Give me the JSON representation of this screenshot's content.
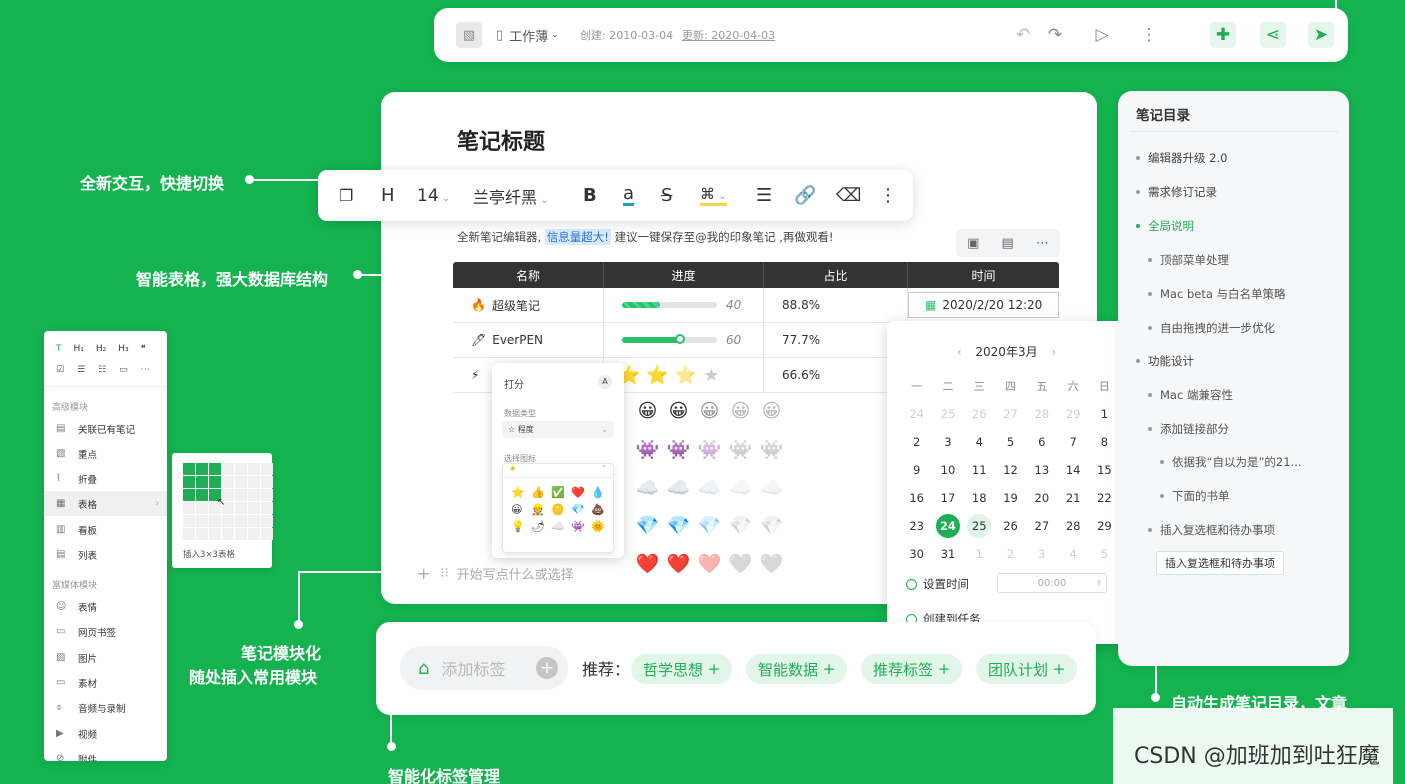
{
  "colors": {
    "accent": "#1fae55",
    "background": "#14b350"
  },
  "topbar": {
    "workbook": "工作薄",
    "created": "创建: 2010-03-04",
    "updated": "更新: 2020-04-03"
  },
  "callouts": {
    "interaction": "全新交互，快捷切换",
    "smart_table": "智能表格，强大数据库结构",
    "modular_1": "笔记模块化",
    "modular_2": "随处插入常用模块",
    "tag_mgmt": "智能化标签管理",
    "toc_auto": "自动生成笔记目录，文章"
  },
  "editor": {
    "title": "笔记标题",
    "para_prefix": "全新笔记编辑器,",
    "para_highlight": "信息量超大!",
    "para_suffix": "建议一键保存至@我的印象笔记 ,再做观看!",
    "placeholder": "开始写点什么或选择"
  },
  "format_toolbar": {
    "heading": "H",
    "size": "14",
    "font": "兰亭纤黑",
    "bold": "B",
    "underline": "a",
    "strike": "S"
  },
  "table": {
    "headers": [
      "名称",
      "进度",
      "占比",
      "时间"
    ],
    "rows": [
      {
        "name": "超级笔记",
        "progress": 40,
        "ratio": "88.8%",
        "time": "2020/2/20 12:20",
        "icon": "🔥"
      },
      {
        "name": "EverPEN",
        "progress": 60,
        "ratio": "77.7%",
        "time": "",
        "icon": "🖊"
      },
      {
        "name": "",
        "progress": null,
        "ratio": "66.6%",
        "time": "",
        "icon": "⚡"
      }
    ]
  },
  "rating_popup": {
    "title": "打分",
    "type_label": "数据类型",
    "type_value": "程度",
    "icon_label": "选择图标"
  },
  "calendar": {
    "month": "2020年3月",
    "weekdays": [
      "一",
      "二",
      "三",
      "四",
      "五",
      "六",
      "日"
    ],
    "days": [
      {
        "d": "24",
        "m": 1
      },
      {
        "d": "25",
        "m": 1
      },
      {
        "d": "26",
        "m": 1
      },
      {
        "d": "27",
        "m": 1
      },
      {
        "d": "28",
        "m": 1
      },
      {
        "d": "29",
        "m": 1
      },
      {
        "d": "1",
        "m": 0
      },
      {
        "d": "2",
        "m": 0
      },
      {
        "d": "3",
        "m": 0
      },
      {
        "d": "4",
        "m": 0
      },
      {
        "d": "5",
        "m": 0
      },
      {
        "d": "6",
        "m": 0
      },
      {
        "d": "7",
        "m": 0
      },
      {
        "d": "8",
        "m": 0
      },
      {
        "d": "9",
        "m": 0
      },
      {
        "d": "10",
        "m": 0
      },
      {
        "d": "11",
        "m": 0
      },
      {
        "d": "12",
        "m": 0
      },
      {
        "d": "13",
        "m": 0
      },
      {
        "d": "14",
        "m": 0
      },
      {
        "d": "15",
        "m": 0
      },
      {
        "d": "16",
        "m": 0
      },
      {
        "d": "17",
        "m": 0
      },
      {
        "d": "18",
        "m": 0
      },
      {
        "d": "19",
        "m": 0
      },
      {
        "d": "20",
        "m": 0
      },
      {
        "d": "21",
        "m": 0
      },
      {
        "d": "22",
        "m": 0
      },
      {
        "d": "23",
        "m": 0
      },
      {
        "d": "24",
        "m": 2
      },
      {
        "d": "25",
        "m": 3
      },
      {
        "d": "26",
        "m": 0
      },
      {
        "d": "27",
        "m": 0
      },
      {
        "d": "28",
        "m": 0
      },
      {
        "d": "29",
        "m": 0
      },
      {
        "d": "30",
        "m": 0
      },
      {
        "d": "31",
        "m": 0
      },
      {
        "d": "1",
        "m": 1
      },
      {
        "d": "2",
        "m": 1
      },
      {
        "d": "3",
        "m": 1
      },
      {
        "d": "4",
        "m": 1
      },
      {
        "d": "5",
        "m": 1
      }
    ],
    "set_time": "设置时间",
    "time_value": "00:00",
    "create_task": "创建到任务"
  },
  "toc": {
    "title": "笔记目录",
    "items": [
      "编辑器升级 2.0",
      "需求修订记录",
      "全局说明",
      "顶部菜单处理",
      "Mac beta 与白名单策略",
      "自由拖拽的进一步优化",
      "功能设计",
      "Mac 端兼容性",
      "添加链接部分",
      "依据我“自以为是”的21...",
      "下面的书单",
      "插入复选框和待办事项"
    ],
    "highlight": "插入复选框和待办事项"
  },
  "blocks": {
    "section_advanced": "高级模块",
    "advanced": [
      "关联已有笔记",
      "重点",
      "折叠",
      "表格",
      "看板",
      "列表"
    ],
    "section_media": "富媒体模块",
    "media": [
      "表情",
      "网页书签",
      "图片",
      "素材",
      "音频与录制",
      "视频",
      "附件"
    ],
    "grid_label": "插入3×3表格"
  },
  "tags": {
    "placeholder": "添加标签",
    "recommend": "推荐：",
    "chips": [
      "哲学思想",
      "智能数据",
      "推荐标签",
      "团队计划"
    ]
  },
  "watermark": "CSDN @加班加到吐狂魔"
}
